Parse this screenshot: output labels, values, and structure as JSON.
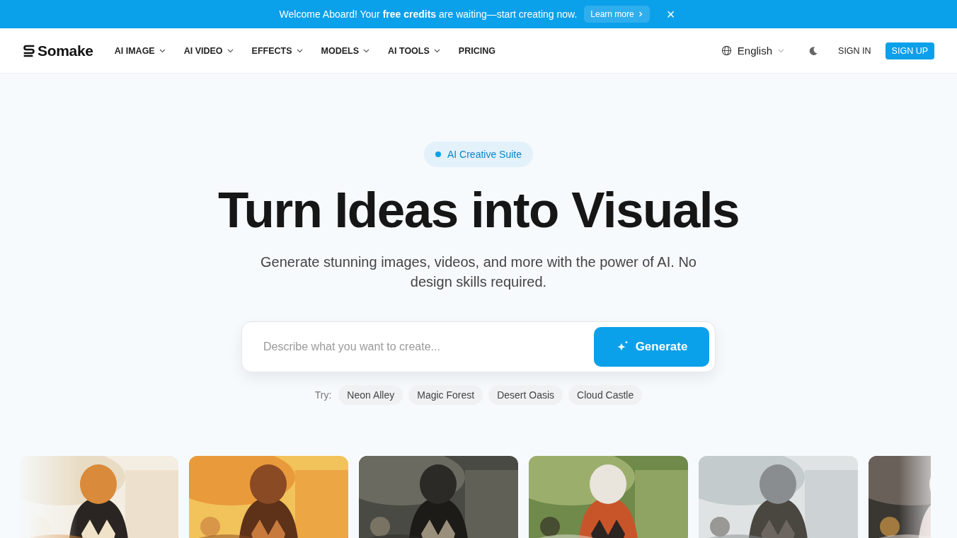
{
  "banner": {
    "text": "Welcome Aboard! Your **free credits** are waiting—start creating now.",
    "link": "Learn more",
    "close": "×"
  },
  "nav": {
    "logo": "Somake",
    "items": [
      {
        "label": "AI IMAGE",
        "dropdown": true
      },
      {
        "label": "AI VIDEO",
        "dropdown": true
      },
      {
        "label": "EFFECTS",
        "dropdown": true
      },
      {
        "label": "MODELS",
        "dropdown": true
      },
      {
        "label": "AI TOOLS",
        "dropdown": true
      },
      {
        "label": "PRICING",
        "dropdown": false
      }
    ],
    "language": "English",
    "sign_in": "SIGN IN",
    "sign_up": "SIGN UP"
  },
  "hero": {
    "badge": "AI Creative Suite",
    "title": "Turn Ideas into Visuals",
    "subtitle": "Generate stunning images, videos, and more with the power of AI. No design skills required.",
    "search": {
      "placeholder": "Describe what you want to create...",
      "button": "Generate"
    },
    "try_label": "Try:",
    "suggestions": [
      "Neon Alley",
      "Magic Forest",
      "Desert Oasis",
      "Cloud Castle"
    ]
  }
}
